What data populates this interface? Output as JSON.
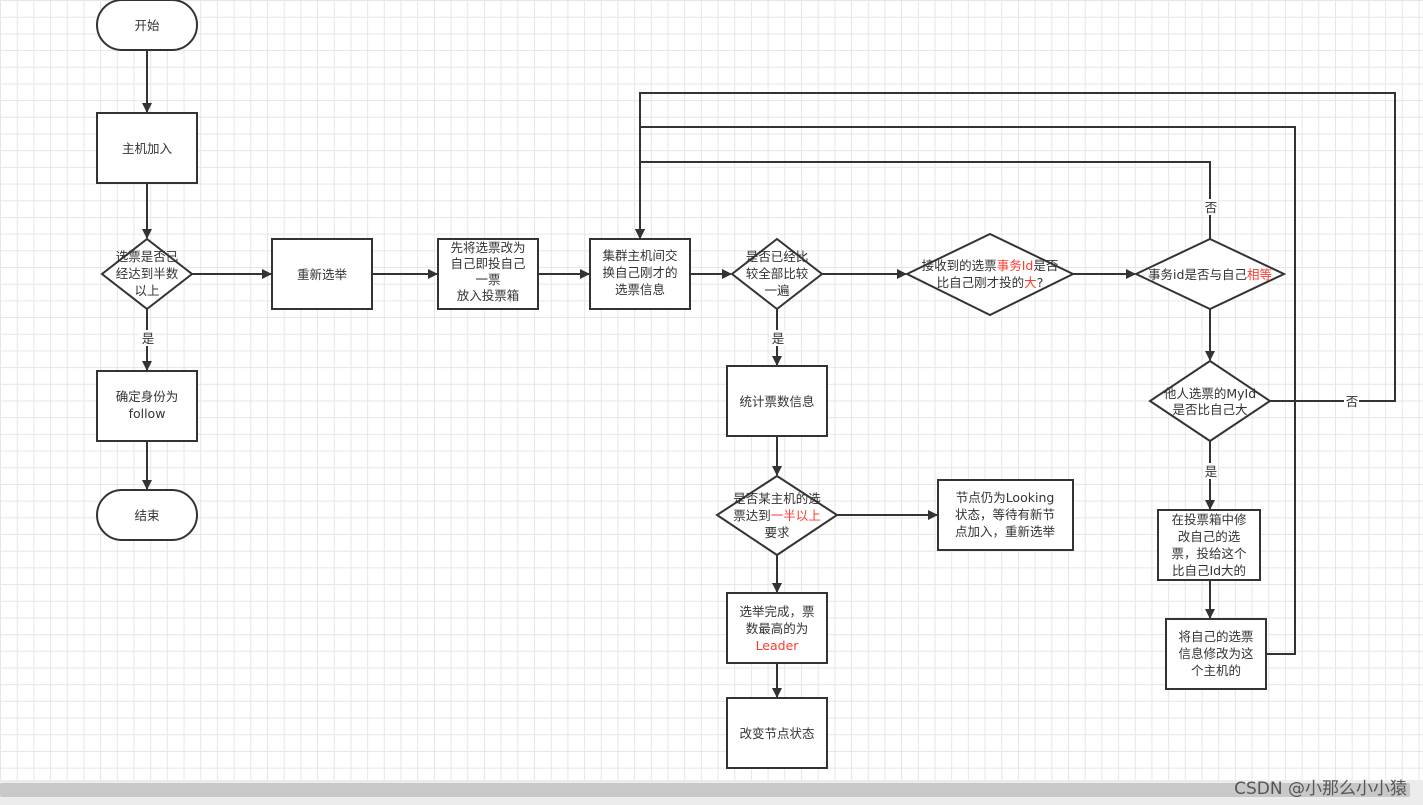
{
  "nodes": {
    "start": {
      "lines": [
        "开始"
      ]
    },
    "join": {
      "lines": [
        "主机加入"
      ]
    },
    "d1": {
      "lines": [
        "选票是否已",
        "经达到半数",
        "以上"
      ]
    },
    "reelect": {
      "lines": [
        "重新选举"
      ]
    },
    "vote_self": {
      "lines": [
        "先将选票改为",
        "自己即投自己",
        "一票",
        "放入投票箱"
      ]
    },
    "exchange": {
      "lines": [
        "集群主机间交",
        "换自己刚才的",
        "选票信息"
      ]
    },
    "d2": {
      "lines": [
        "是否已经比",
        "较全部比较",
        "一遍"
      ]
    },
    "d3": {
      "lines": [
        [
          "接收到的选票",
          "事务Id",
          "是否"
        ],
        [
          "比自己刚才投的",
          "大",
          "?"
        ]
      ]
    },
    "d4": {
      "lines": [
        [
          "事务id是否与自己",
          "相等"
        ]
      ]
    },
    "d5": {
      "lines": [
        "他人选票的MyId",
        "是否比自己大"
      ]
    },
    "modify": {
      "lines": [
        "在投票箱中修",
        "改自己的选",
        "票，投给这个",
        "比自己Id大的"
      ]
    },
    "change_vote": {
      "lines": [
        "将自己的选票",
        "信息修改为这",
        "个主机的"
      ]
    },
    "follow": {
      "lines": [
        "确定身份为",
        "follow"
      ]
    },
    "end": {
      "lines": [
        "结束"
      ]
    },
    "count": {
      "lines": [
        "统计票数信息"
      ]
    },
    "d6": {
      "lines": [
        [
          "是否某主机的选"
        ],
        [
          "票达到",
          "一半以上"
        ],
        [
          "要求"
        ]
      ]
    },
    "looking": {
      "lines": [
        "节点仍为Looking",
        "状态，等待有新节",
        "点加入，重新选举"
      ]
    },
    "done": {
      "lines": [
        "选举完成，票",
        "数最高的为",
        "Leader"
      ]
    },
    "change_state": {
      "lines": [
        "改变节点状态"
      ]
    }
  },
  "edge_labels": {
    "yes": "是",
    "no": "否"
  },
  "colors": {
    "highlight": "#ff3b30",
    "stroke": "#333333"
  },
  "watermark": "CSDN @小那么小小猿"
}
